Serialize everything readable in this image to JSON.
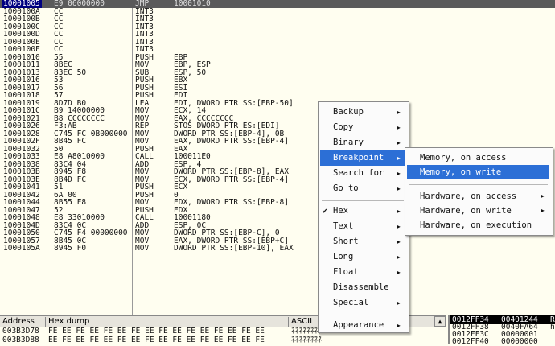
{
  "disasm": {
    "rows": [
      {
        "addr": "10001005",
        "hex": "E9 06000000",
        "mn": "JMP",
        "op": "10001010",
        "selected": true
      },
      {
        "addr": "1000100A",
        "hex": "CC",
        "mn": "INT3",
        "op": ""
      },
      {
        "addr": "1000100B",
        "hex": "CC",
        "mn": "INT3",
        "op": ""
      },
      {
        "addr": "1000100C",
        "hex": "CC",
        "mn": "INT3",
        "op": ""
      },
      {
        "addr": "1000100D",
        "hex": "CC",
        "mn": "INT3",
        "op": ""
      },
      {
        "addr": "1000100E",
        "hex": "CC",
        "mn": "INT3",
        "op": ""
      },
      {
        "addr": "1000100F",
        "hex": "CC",
        "mn": "INT3",
        "op": ""
      },
      {
        "addr": "10001010",
        "hex": "55",
        "mn": "PUSH",
        "op": "EBP"
      },
      {
        "addr": "10001011",
        "hex": "8BEC",
        "mn": "MOV",
        "op": "EBP, ESP"
      },
      {
        "addr": "10001013",
        "hex": "83EC 50",
        "mn": "SUB",
        "op": "ESP, 50"
      },
      {
        "addr": "10001016",
        "hex": "53",
        "mn": "PUSH",
        "op": "EBX"
      },
      {
        "addr": "10001017",
        "hex": "56",
        "mn": "PUSH",
        "op": "ESI"
      },
      {
        "addr": "10001018",
        "hex": "57",
        "mn": "PUSH",
        "op": "EDI"
      },
      {
        "addr": "10001019",
        "hex": "8D7D B0",
        "mn": "LEA",
        "op": "EDI, DWORD PTR SS:[EBP-50]"
      },
      {
        "addr": "1000101C",
        "hex": "B9 14000000",
        "mn": "MOV",
        "op": "ECX, 14"
      },
      {
        "addr": "10001021",
        "hex": "B8 CCCCCCCC",
        "mn": "MOV",
        "op": "EAX, CCCCCCCC"
      },
      {
        "addr": "10001026",
        "hex": "F3:AB",
        "mn": "REP",
        "op": "STOS DWORD PTR ES:[EDI]"
      },
      {
        "addr": "10001028",
        "hex": "C745 FC 0B000000",
        "mn": "MOV",
        "op": "DWORD PTR SS:[EBP-4], 0B"
      },
      {
        "addr": "1000102F",
        "hex": "8B45 FC",
        "mn": "MOV",
        "op": "EAX, DWORD PTR SS:[EBP-4]"
      },
      {
        "addr": "10001032",
        "hex": "50",
        "mn": "PUSH",
        "op": "EAX"
      },
      {
        "addr": "10001033",
        "hex": "E8 A8010000",
        "mn": "CALL",
        "op": "100011E0"
      },
      {
        "addr": "10001038",
        "hex": "83C4 04",
        "mn": "ADD",
        "op": "ESP, 4"
      },
      {
        "addr": "1000103B",
        "hex": "8945 F8",
        "mn": "MOV",
        "op": "DWORD PTR SS:[EBP-8], EAX"
      },
      {
        "addr": "1000103E",
        "hex": "8B4D FC",
        "mn": "MOV",
        "op": "ECX, DWORD PTR SS:[EBP-4]"
      },
      {
        "addr": "10001041",
        "hex": "51",
        "mn": "PUSH",
        "op": "ECX"
      },
      {
        "addr": "10001042",
        "hex": "6A 00",
        "mn": "PUSH",
        "op": "0"
      },
      {
        "addr": "10001044",
        "hex": "8B55 F8",
        "mn": "MOV",
        "op": "EDX, DWORD PTR SS:[EBP-8]"
      },
      {
        "addr": "10001047",
        "hex": "52",
        "mn": "PUSH",
        "op": "EDX"
      },
      {
        "addr": "10001048",
        "hex": "E8 33010000",
        "mn": "CALL",
        "op": "10001180"
      },
      {
        "addr": "1000104D",
        "hex": "83C4 0C",
        "mn": "ADD",
        "op": "ESP, 0C"
      },
      {
        "addr": "10001050",
        "hex": "C745 F4 00000000",
        "mn": "MOV",
        "op": "DWORD PTR SS:[EBP-C], 0"
      },
      {
        "addr": "10001057",
        "hex": "8B45 0C",
        "mn": "MOV",
        "op": "EAX, DWORD PTR SS:[EBP+C]"
      },
      {
        "addr": "1000105A",
        "hex": "8945 F0",
        "mn": "MOV",
        "op": "DWORD PTR SS:[EBP-10], EAX"
      }
    ]
  },
  "dump": {
    "headers": {
      "address": "Address",
      "hex": "Hex dump",
      "ascii": "ASCII"
    },
    "rows": [
      {
        "addr": "003B3D78",
        "hex": "FE EE FE EE FE EE FE EE FE EE FE EE FE EE FE EE",
        "ascii": "ﾈﾈﾈﾈﾈﾈﾈﾈ"
      },
      {
        "addr": "003B3D88",
        "hex": "EE FE EE FE EE FE EE FE EE FE EE FE EE FE EE FE",
        "ascii": "ﾈﾈﾈﾈﾈﾈﾈﾈ"
      }
    ],
    "scroll_up_icon": "triangle-up"
  },
  "stack": {
    "rows": [
      {
        "addr": "0012FF34",
        "val": "00401244",
        "extra": "R",
        "selected": true
      },
      {
        "addr": "0012FF38",
        "val": "0040FA64",
        "extra": "he"
      },
      {
        "addr": "0012FF3C",
        "val": "00000001",
        "extra": ""
      },
      {
        "addr": "0012FF40",
        "val": "00000000",
        "extra": ""
      }
    ]
  },
  "context_menu": {
    "items": [
      {
        "label": "Backup",
        "submenu": true
      },
      {
        "label": "Copy",
        "submenu": true
      },
      {
        "label": "Binary",
        "submenu": true
      },
      {
        "label": "Breakpoint",
        "submenu": true,
        "highlighted": true
      },
      {
        "label": "Search for",
        "submenu": true
      },
      {
        "label": "Go to",
        "submenu": true
      },
      {
        "sep": true
      },
      {
        "label": "Hex",
        "submenu": true,
        "checked": true
      },
      {
        "label": "Text",
        "submenu": true
      },
      {
        "label": "Short",
        "submenu": true
      },
      {
        "label": "Long",
        "submenu": true
      },
      {
        "label": "Float",
        "submenu": true
      },
      {
        "label": "Disassemble",
        "submenu": false
      },
      {
        "label": "Special",
        "submenu": true
      },
      {
        "sep": true
      },
      {
        "label": "Appearance",
        "submenu": true
      }
    ]
  },
  "breakpoint_submenu": {
    "items": [
      {
        "label": "Memory, on access",
        "submenu": false
      },
      {
        "label": "Memory, on write",
        "submenu": false,
        "highlighted": true
      },
      {
        "sep": true
      },
      {
        "label": "Hardware, on access",
        "submenu": true
      },
      {
        "label": "Hardware, on write",
        "submenu": true
      },
      {
        "label": "Hardware, on execution",
        "submenu": false
      }
    ]
  },
  "colors": {
    "highlight": "#2c6fd6",
    "background": "#fffef0",
    "selection": "#000080"
  }
}
